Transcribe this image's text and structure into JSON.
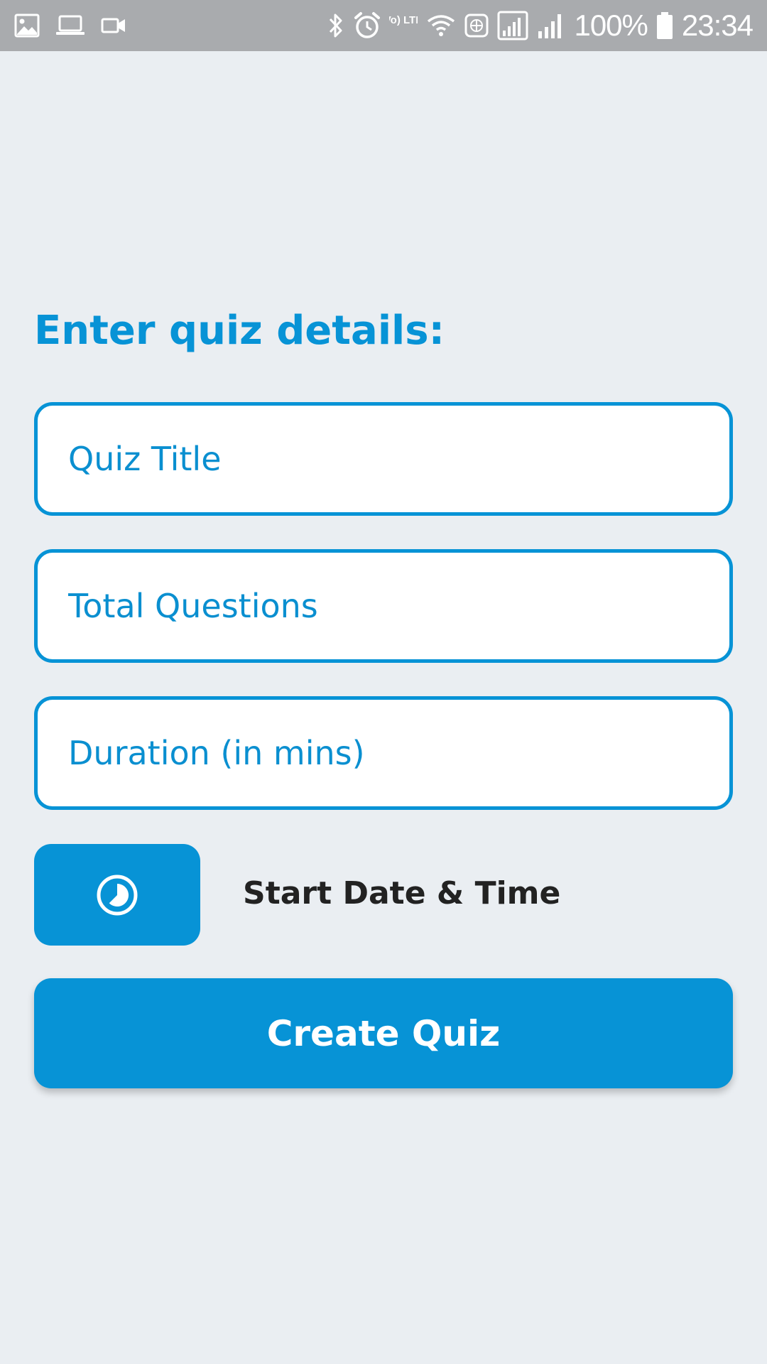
{
  "status_bar": {
    "left_icons": [
      "image-icon",
      "laptop-icon",
      "video-camera-icon"
    ],
    "right_icons": [
      "bluetooth-icon",
      "alarm-icon",
      "volte-icon",
      "wifi-icon",
      "data-saver-icon",
      "signal-icon",
      "signal-icon-2",
      "battery-icon"
    ],
    "volte_text": "Vo) LTE",
    "battery": "100%",
    "time": "23:34"
  },
  "form": {
    "heading": "Enter quiz details:",
    "quiz_title_placeholder": "Quiz Title",
    "total_questions_placeholder": "Total Questions",
    "duration_placeholder": "Duration (in mins)",
    "time_picker_icon": "clock-icon",
    "start_label": "Start Date & Time",
    "create_button": "Create Quiz"
  },
  "colors": {
    "accent": "#0793d6",
    "background": "#eaeef2",
    "status_bar": "#a9abae"
  }
}
